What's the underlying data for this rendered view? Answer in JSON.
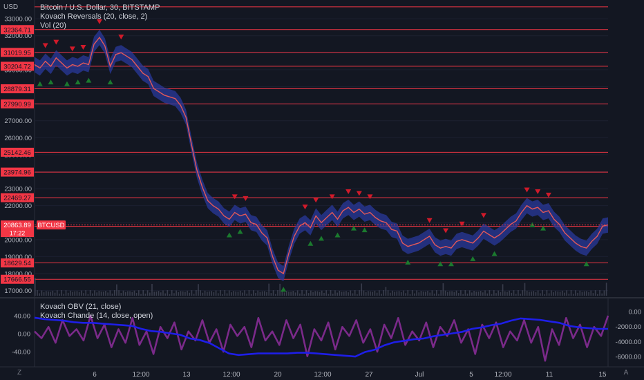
{
  "header": {
    "currency": "USD",
    "title": "Bitcoin / U.S. Dollar, 30, BITSTAMP",
    "indicator_1": "Kovach Reversals (20, close, 2)",
    "indicator_2": "Vol (20)"
  },
  "lower_pane": {
    "indicator_1": "Kovach OBV (21, close)",
    "indicator_2": "Kovach Chande (14, close, open)"
  },
  "symbol": "BTCUSD",
  "current_price": "20863.89",
  "countdown": "17:22",
  "price_ticks": [
    "33000.00",
    "32000.00",
    "31000.00",
    "30000.00",
    "29000.00",
    "28000.00",
    "27000.00",
    "26000.00",
    "25000.00",
    "24000.00",
    "23000.00",
    "22000.00",
    "21000.00",
    "20000.00",
    "19000.00",
    "18000.00",
    "17000.00"
  ],
  "level_lines": [
    {
      "price": "32364.71",
      "value": 32364.71
    },
    {
      "price": "31019.95",
      "value": 31019.95
    },
    {
      "price": "30204.72",
      "value": 30204.72
    },
    {
      "price": "28879.31",
      "value": 28879.31
    },
    {
      "price": "27990.99",
      "value": 27990.99
    },
    {
      "price": "25142.46",
      "value": 25142.46
    },
    {
      "price": "23974.96",
      "value": 23974.96
    },
    {
      "price": "22469.27",
      "value": 22469.27
    },
    {
      "price": "20780.43",
      "value": 20780.43
    },
    {
      "price": "18629.54",
      "value": 18629.54
    },
    {
      "price": "17666.55",
      "value": 17666.55
    }
  ],
  "lower_left_ticks": [
    "40.00",
    "0.00",
    "-40.00"
  ],
  "lower_right_ticks": [
    "0.00",
    "-2000.00",
    "-4000.00",
    "-6000.00"
  ],
  "time_ticks": [
    "6",
    "12:00",
    "13",
    "12:00",
    "20",
    "12:00",
    "27",
    "Jul",
    "5",
    "12:00",
    "11",
    "15"
  ],
  "corner_left": "Z",
  "corner_right": "A",
  "colors": {
    "background": "#131722",
    "level_line": "#f23645",
    "level_label_bg": "#f23645",
    "price_label_bg": "#f23645",
    "up_marker": "#1b7a2e",
    "down_marker": "#d11a2a",
    "band": "#2a3a9c",
    "price_line": "#e35959",
    "obv_line": "#1e1ee8",
    "chande_line": "#7b2a8a"
  },
  "chart_data": [
    {
      "type": "line",
      "title": "Bitcoin / U.S. Dollar, 30, BITSTAMP",
      "ylim": [
        16700,
        33900
      ],
      "ylabel": "USD",
      "series": [
        {
          "values": [
            30300,
            30100,
            30500,
            30200,
            30700,
            30400,
            30100,
            30300,
            30200,
            30400,
            30300,
            31500,
            31900,
            31400,
            30200,
            30900,
            31000,
            30800,
            30600,
            30200,
            29800,
            29600,
            28900,
            28700,
            28500,
            28400,
            28300,
            27900,
            27200,
            25600,
            24100,
            23100,
            22300,
            22000,
            21800,
            21400,
            21200,
            21600,
            21400,
            21500,
            21000,
            20900,
            20400,
            20100,
            19000,
            18200,
            18000,
            19200,
            20200,
            20800,
            21000,
            20700,
            21400,
            21000,
            21300,
            21600,
            21200,
            21700,
            21900,
            21600,
            21800,
            21500,
            21600,
            21300,
            21100,
            21000,
            20600,
            20500,
            19800,
            19600,
            19700,
            19800,
            20000,
            20200,
            19700,
            19500,
            19600,
            19500,
            19900,
            20000,
            19900,
            19800,
            20100,
            20500,
            20300,
            20100,
            20300,
            20600,
            20900,
            21100,
            21600,
            22000,
            21800,
            21900,
            21600,
            21700,
            21200,
            20900,
            20400,
            20100,
            19800,
            19600,
            19500,
            19900,
            20200,
            20800,
            20864
          ]
        }
      ]
    },
    {
      "type": "line",
      "title": "Kovach OBV (21, close)",
      "ylim": [
        -7300,
        1400
      ],
      "series": [
        {
          "values": [
            -800,
            -1000,
            -1100,
            -1200,
            -1400,
            -1500,
            -1500,
            -1600,
            -1700,
            -1800,
            -1900,
            -2300,
            -2600,
            -2700,
            -2900,
            -3100,
            -3600,
            -3800,
            -4200,
            -4900,
            -5600,
            -5800,
            -5700,
            -5600,
            -5600,
            -5600,
            -5600,
            -5500,
            -5500,
            -5600,
            -5700,
            -5800,
            -5900,
            -6000,
            -5400,
            -5100,
            -4500,
            -4100,
            -3900,
            -3700,
            -3600,
            -3300,
            -3100,
            -2900,
            -2700,
            -2300,
            -2100,
            -1800,
            -1600,
            -1200,
            -900,
            -1000,
            -1100,
            -1300,
            -1500,
            -1900,
            -2100,
            -2200,
            -2300,
            -2300
          ]
        }
      ]
    },
    {
      "type": "line",
      "title": "Kovach Chande (14, close, open)",
      "ylim": [
        -72,
        72
      ],
      "series": [
        {
          "values": [
            5,
            -10,
            15,
            -20,
            30,
            -5,
            10,
            -15,
            40,
            -10,
            20,
            -30,
            10,
            -20,
            35,
            -25,
            5,
            -45,
            15,
            -10,
            25,
            -35,
            5,
            -15,
            30,
            -20,
            10,
            -40,
            20,
            -5,
            15,
            -30,
            35,
            -15,
            5,
            -25,
            30,
            -10,
            20,
            -50,
            10,
            -15,
            25,
            -35,
            15,
            -5,
            30,
            -20,
            10,
            -40,
            20,
            -10,
            35,
            -25,
            5,
            -15,
            25,
            -30,
            15,
            -5,
            30,
            -20,
            10,
            -45,
            20,
            -10,
            25,
            -30,
            5,
            -15,
            30,
            -20,
            15,
            -60,
            10,
            -25,
            35,
            -10,
            20,
            -30,
            15,
            -5,
            40
          ]
        }
      ]
    }
  ]
}
